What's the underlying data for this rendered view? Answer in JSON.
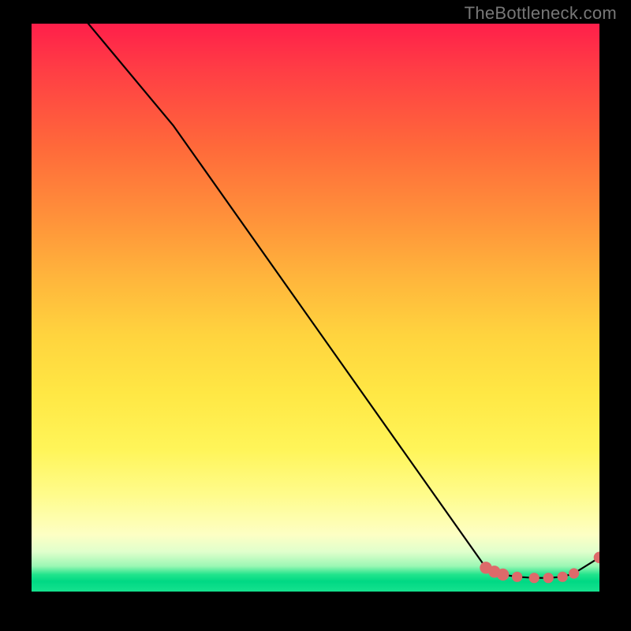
{
  "attribution": "TheBottleneck.com",
  "chart_data": {
    "type": "line",
    "title": "",
    "xlabel": "",
    "ylabel": "",
    "xlim": [
      0,
      100
    ],
    "ylim": [
      0,
      100
    ],
    "series": [
      {
        "name": "main-curve",
        "x": [
          0,
          10,
          25,
          80,
          83,
          85.5,
          88.5,
          91,
          93.5,
          95.5,
          100
        ],
        "y": [
          110,
          100,
          82,
          4.2,
          3.0,
          2.6,
          2.4,
          2.4,
          2.6,
          3.2,
          6.0
        ]
      }
    ],
    "markers": [
      {
        "name": "m1",
        "x": 80.0,
        "y": 4.2,
        "r": 1.3
      },
      {
        "name": "m2",
        "x": 81.5,
        "y": 3.5,
        "r": 1.3
      },
      {
        "name": "m3",
        "x": 83.0,
        "y": 3.0,
        "r": 1.3
      },
      {
        "name": "m4",
        "x": 85.5,
        "y": 2.6,
        "r": 1.0
      },
      {
        "name": "m5",
        "x": 88.5,
        "y": 2.4,
        "r": 1.0
      },
      {
        "name": "m6",
        "x": 91.0,
        "y": 2.4,
        "r": 1.0
      },
      {
        "name": "m7",
        "x": 93.5,
        "y": 2.6,
        "r": 1.0
      },
      {
        "name": "m8",
        "x": 95.5,
        "y": 3.2,
        "r": 1.0
      },
      {
        "name": "m9",
        "x": 100.0,
        "y": 6.0,
        "r": 1.2
      }
    ],
    "colors": {
      "line": "#000000",
      "marker": "#dd6a6a"
    }
  }
}
